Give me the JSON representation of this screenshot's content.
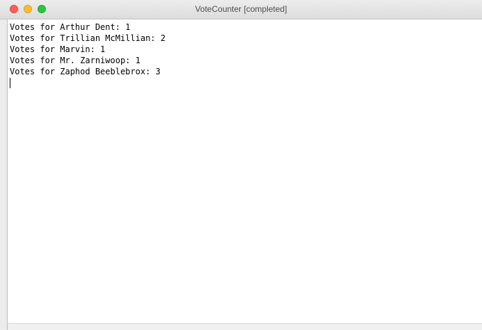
{
  "window": {
    "title": "VoteCounter [completed]"
  },
  "console": {
    "lines": [
      "Votes for Arthur Dent: 1",
      "Votes for Trillian McMillian: 2",
      "Votes for Marvin: 1",
      "Votes for Mr. Zarniwoop: 1",
      "Votes for Zaphod Beeblebrox: 3"
    ]
  },
  "colors": {
    "close": "#fc5f57",
    "minimize": "#fdbc2e",
    "maximize": "#28c840"
  },
  "icons": {
    "close": "close-icon",
    "minimize": "minimize-icon",
    "maximize": "maximize-icon"
  }
}
